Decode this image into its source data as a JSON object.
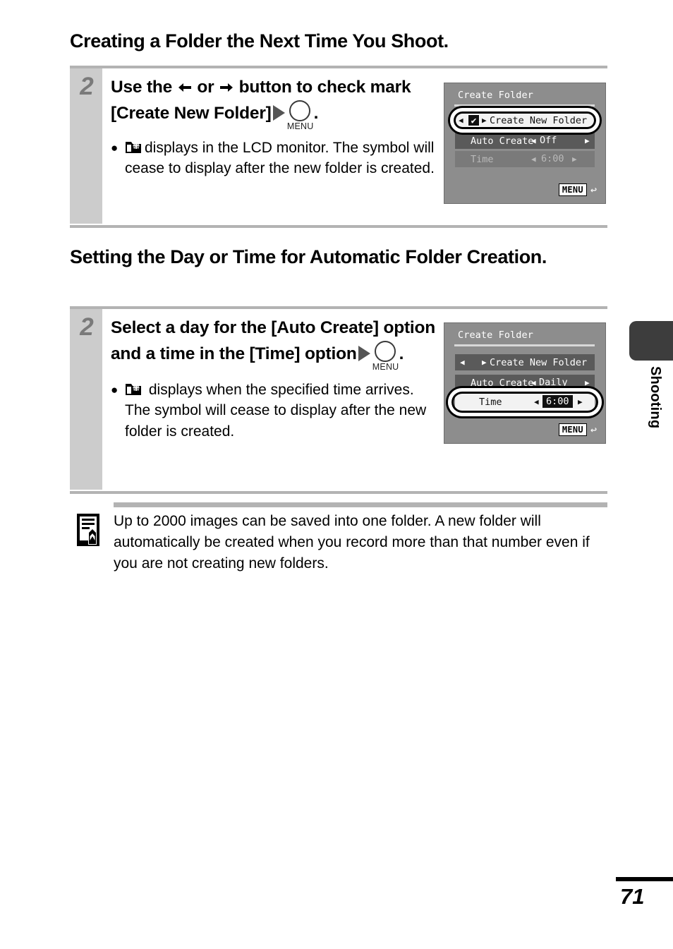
{
  "document": {
    "page_number": "71",
    "side_tab_label": "Shooting"
  },
  "headings": {
    "main": "Creating a Folder the Next Time You Shoot.",
    "second": "Setting the Day or Time for Automatic Folder Creation."
  },
  "steps": [
    {
      "number": "2",
      "title_parts": {
        "p1": "Use the",
        "p2": "or",
        "p3": "button to check mark [Create New Folder]",
        "p4": "."
      },
      "menu_button_label": "MENU",
      "bullets": [
        {
          "icon": "new-folder-icon",
          "text": "displays in the LCD monitor. The symbol will cease to display after the new folder is created."
        }
      ]
    },
    {
      "number": "2",
      "title_parts": {
        "p1": "Select a day for the [Auto Create] option and a time in the [Time] option",
        "p4": "."
      },
      "menu_button_label": "MENU",
      "bullets": [
        {
          "icon": "new-folder-icon",
          "text": "displays when the specified time arrives. The symbol will cease to display after the new folder is created."
        }
      ]
    }
  ],
  "lcd_screens": [
    {
      "id": "create-folder-checkmark",
      "title": "Create Folder",
      "rows": [
        {
          "label": "Create New Folder",
          "value": "",
          "checkbox": "✔",
          "state": "highlighted-white",
          "left_caret": "◀",
          "right_caret": "▶"
        },
        {
          "label": "Auto Create",
          "value": "Off",
          "state": "enabled-dark",
          "left_caret": "◀",
          "right_caret": "▶"
        },
        {
          "label": "Time",
          "value": "6:00",
          "state": "disabled",
          "left_caret": "◀",
          "right_caret": "▶"
        }
      ],
      "menu_badge": "MENU",
      "return_icon": "↩",
      "selection_row_index": 0
    },
    {
      "id": "create-folder-time",
      "title": "Create Folder",
      "rows": [
        {
          "label": "Create New Folder",
          "value": "",
          "checkbox": "",
          "state": "enabled-dark",
          "left_caret": "◀",
          "right_caret": "▶"
        },
        {
          "label": "Auto Create",
          "value": "Daily",
          "state": "enabled-dark",
          "left_caret": "◀",
          "right_caret": "▶"
        },
        {
          "label": "Time",
          "value": "6:00",
          "state": "selected-white",
          "left_caret": "◀",
          "right_caret": "▶"
        }
      ],
      "menu_badge": "MENU",
      "return_icon": "↩",
      "selection_row_index": 2
    }
  ],
  "note": {
    "icon": "memo-pencil-icon",
    "text": "Up to 2000 images can be saved into one folder. A new folder will automatically be created when you record more than that number even if you are not creating new folders."
  },
  "colors": {
    "gray_rule": "#b3b3b3",
    "step_band": "#cccccc",
    "step_number": "#7a7a7a",
    "lcd_background": "#8d8d8d",
    "lcd_row_dark": "#5a5a5a",
    "tab_swatch": "#3d3d3d"
  }
}
